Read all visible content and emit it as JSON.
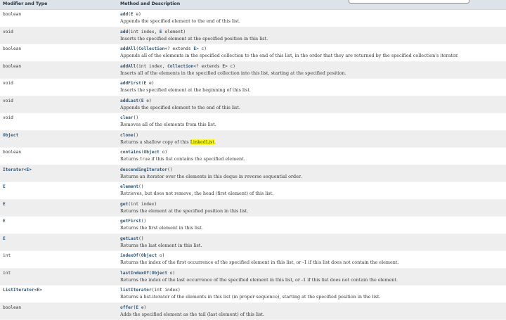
{
  "headers": {
    "type": "Modifier and Type",
    "method": "Method and Description"
  },
  "rows": [
    {
      "type": "boolean",
      "link": false,
      "alt": false,
      "sig": [
        [
          "add",
          "m"
        ],
        [
          "(",
          ""
        ],
        [
          "E",
          "k"
        ],
        [
          " e)",
          ""
        ]
      ],
      "desc": [
        [
          "Appends the specified element to the end of this list.",
          ""
        ]
      ]
    },
    {
      "type": "void",
      "link": false,
      "alt": true,
      "sig": [
        [
          "add",
          "m"
        ],
        [
          "(int index, ",
          ""
        ],
        [
          "E",
          "k"
        ],
        [
          " element)",
          ""
        ]
      ],
      "desc": [
        [
          "Inserts the specified element at the specified position in this list.",
          ""
        ]
      ]
    },
    {
      "type": "boolean",
      "link": false,
      "alt": false,
      "sig": [
        [
          "addAll",
          "m"
        ],
        [
          "(",
          ""
        ],
        [
          "Collection",
          "k"
        ],
        [
          "<? extends ",
          ""
        ],
        [
          "E",
          "k"
        ],
        [
          "> c)",
          ""
        ]
      ],
      "desc": [
        [
          "Appends all of the elements in the specified collection to the end of this list, in the order that they are returned by the specified collection's iterator.",
          ""
        ]
      ]
    },
    {
      "type": "boolean",
      "link": false,
      "alt": true,
      "sig": [
        [
          "addAll",
          "m"
        ],
        [
          "(int index, ",
          ""
        ],
        [
          "Collection",
          "k"
        ],
        [
          "<? extends ",
          ""
        ],
        [
          "E",
          "k"
        ],
        [
          "> c)",
          ""
        ]
      ],
      "desc": [
        [
          "Inserts all of the elements in the specified collection into this list, starting at the specified position.",
          ""
        ]
      ]
    },
    {
      "type": "void",
      "link": false,
      "alt": false,
      "sig": [
        [
          "addFirst",
          "m"
        ],
        [
          "(",
          ""
        ],
        [
          "E",
          "k"
        ],
        [
          " e)",
          ""
        ]
      ],
      "desc": [
        [
          "Inserts the specified element at the beginning of this list.",
          ""
        ]
      ]
    },
    {
      "type": "void",
      "link": false,
      "alt": true,
      "sig": [
        [
          "addLast",
          "m"
        ],
        [
          "(",
          ""
        ],
        [
          "E",
          "k"
        ],
        [
          " e)",
          ""
        ]
      ],
      "desc": [
        [
          "Appends the specified element to the end of this list.",
          ""
        ]
      ]
    },
    {
      "type": "void",
      "link": false,
      "alt": false,
      "sig": [
        [
          "clear",
          "m"
        ],
        [
          "()",
          ""
        ]
      ],
      "desc": [
        [
          "Removes all of the elements from this list.",
          ""
        ]
      ]
    },
    {
      "type": "Object",
      "link": true,
      "alt": true,
      "sig": [
        [
          "clone",
          "m"
        ],
        [
          "()",
          ""
        ]
      ],
      "desc": [
        [
          "Returns a shallow copy of this ",
          ""
        ],
        [
          "LinkedList",
          "hl"
        ],
        [
          ".",
          ""
        ]
      ]
    },
    {
      "type": "boolean",
      "link": false,
      "alt": false,
      "sig": [
        [
          "contains",
          "m"
        ],
        [
          "(",
          ""
        ],
        [
          "Object",
          "k"
        ],
        [
          " o)",
          ""
        ]
      ],
      "desc": [
        [
          "Returns ",
          ""
        ],
        [
          "true",
          "code"
        ],
        [
          " if this list contains the specified element.",
          ""
        ]
      ]
    },
    {
      "type": "Iterator<E>",
      "link": true,
      "alt": true,
      "sig": [
        [
          "descendingIterator",
          "m"
        ],
        [
          "()",
          ""
        ]
      ],
      "desc": [
        [
          "Returns an iterator over the elements in this deque in reverse sequential order.",
          ""
        ]
      ]
    },
    {
      "type": "E",
      "link": true,
      "alt": false,
      "sig": [
        [
          "element",
          "m"
        ],
        [
          "()",
          ""
        ]
      ],
      "desc": [
        [
          "Retrieves, but does not remove, the head (first element) of this list.",
          ""
        ]
      ]
    },
    {
      "type": "E",
      "link": true,
      "alt": true,
      "sig": [
        [
          "get",
          "m"
        ],
        [
          "(int index)",
          ""
        ]
      ],
      "desc": [
        [
          "Returns the element at the specified position in this list.",
          ""
        ]
      ]
    },
    {
      "type": "E",
      "link": true,
      "alt": false,
      "sig": [
        [
          "getFirst",
          "m"
        ],
        [
          "()",
          ""
        ]
      ],
      "desc": [
        [
          "Returns the first element in this list.",
          ""
        ]
      ]
    },
    {
      "type": "E",
      "link": true,
      "alt": true,
      "sig": [
        [
          "getLast",
          "m"
        ],
        [
          "()",
          ""
        ]
      ],
      "desc": [
        [
          "Returns the last element in this list.",
          ""
        ]
      ]
    },
    {
      "type": "int",
      "link": false,
      "alt": false,
      "sig": [
        [
          "indexOf",
          "m"
        ],
        [
          "(",
          ""
        ],
        [
          "Object",
          "k"
        ],
        [
          " o)",
          ""
        ]
      ],
      "desc": [
        [
          "Returns the index of the first occurrence of the specified element in this list, or -1 if this list does not contain the element.",
          ""
        ]
      ]
    },
    {
      "type": "int",
      "link": false,
      "alt": true,
      "sig": [
        [
          "lastIndexOf",
          "m"
        ],
        [
          "(",
          ""
        ],
        [
          "Object",
          "k"
        ],
        [
          " o)",
          ""
        ]
      ],
      "desc": [
        [
          "Returns the index of the last occurrence of the specified element in this list, or -1 if this list does not contain the element.",
          ""
        ]
      ]
    },
    {
      "type": "ListIterator<E>",
      "link": true,
      "alt": false,
      "sig": [
        [
          "listIterator",
          "m"
        ],
        [
          "(int index)",
          ""
        ]
      ],
      "desc": [
        [
          "Returns a list-iterator of the elements in this list (in proper sequence), starting at the specified position in the list.",
          ""
        ]
      ]
    },
    {
      "type": "boolean",
      "link": false,
      "alt": true,
      "sig": [
        [
          "offer",
          "m"
        ],
        [
          "(",
          ""
        ],
        [
          "E",
          "k"
        ],
        [
          " e)",
          ""
        ]
      ],
      "desc": [
        [
          "Adds the specified element as the tail (last element) of this list.",
          ""
        ]
      ]
    }
  ]
}
